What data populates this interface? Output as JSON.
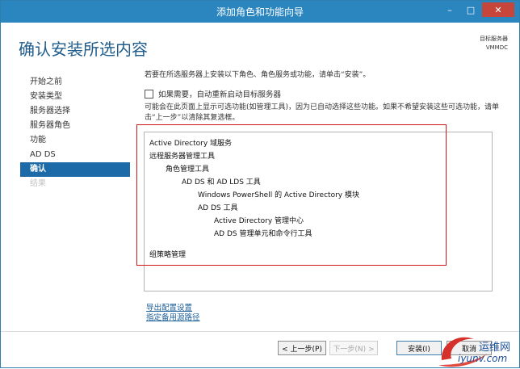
{
  "window": {
    "title": "添加角色和功能向导",
    "btn_min": "–",
    "btn_max": "□",
    "btn_close": "✕"
  },
  "page": {
    "heading": "确认安装所选内容",
    "target_label": "目标服务器",
    "target_value": "VMMDC"
  },
  "nav": {
    "items": [
      {
        "label": "开始之前",
        "state": "normal"
      },
      {
        "label": "安装类型",
        "state": "normal"
      },
      {
        "label": "服务器选择",
        "state": "normal"
      },
      {
        "label": "服务器角色",
        "state": "normal"
      },
      {
        "label": "功能",
        "state": "normal"
      },
      {
        "label": "AD DS",
        "state": "normal"
      },
      {
        "label": "确认",
        "state": "active"
      },
      {
        "label": "结果",
        "state": "disabled"
      }
    ]
  },
  "content": {
    "intro": "若要在所选服务器上安装以下角色、角色服务或功能，请单击“安装”。",
    "restart_label": "如果需要，自动重新启动目标服务器",
    "note": "可能会在此页面上显示可选功能(如管理工具)，因为已自动选择这些功能。如果不希望安装这些可选功能，请单击“上一步”以清除其复选框。",
    "items": [
      {
        "text": "Active Directory 域服务",
        "indent": 0
      },
      {
        "text": "远程服务器管理工具",
        "indent": 0
      },
      {
        "text": "角色管理工具",
        "indent": 1
      },
      {
        "text": "AD DS 和 AD LDS 工具",
        "indent": 2
      },
      {
        "text": "Windows PowerShell 的 Active Directory 模块",
        "indent": 3
      },
      {
        "text": "AD DS 工具",
        "indent": 3
      },
      {
        "text": "Active Directory 管理中心",
        "indent": 4
      },
      {
        "text": "AD DS 管理单元和命令行工具",
        "indent": 4
      },
      {
        "text": "组策略管理",
        "indent": 0
      }
    ],
    "export_link": "导出配置设置",
    "alt_source_link": "指定备用源路径"
  },
  "buttons": {
    "prev": "< 上一步(P)",
    "next": "下一步(N) >",
    "install": "安装(I)",
    "cancel": "取消"
  },
  "watermark": {
    "line1": "运维网",
    "line2": "iyunv.com"
  },
  "colors": {
    "titlebar": "#2b86c0",
    "accent": "#1c6aa8",
    "heading": "#1f5c8c",
    "highlight_box": "#d01818"
  }
}
